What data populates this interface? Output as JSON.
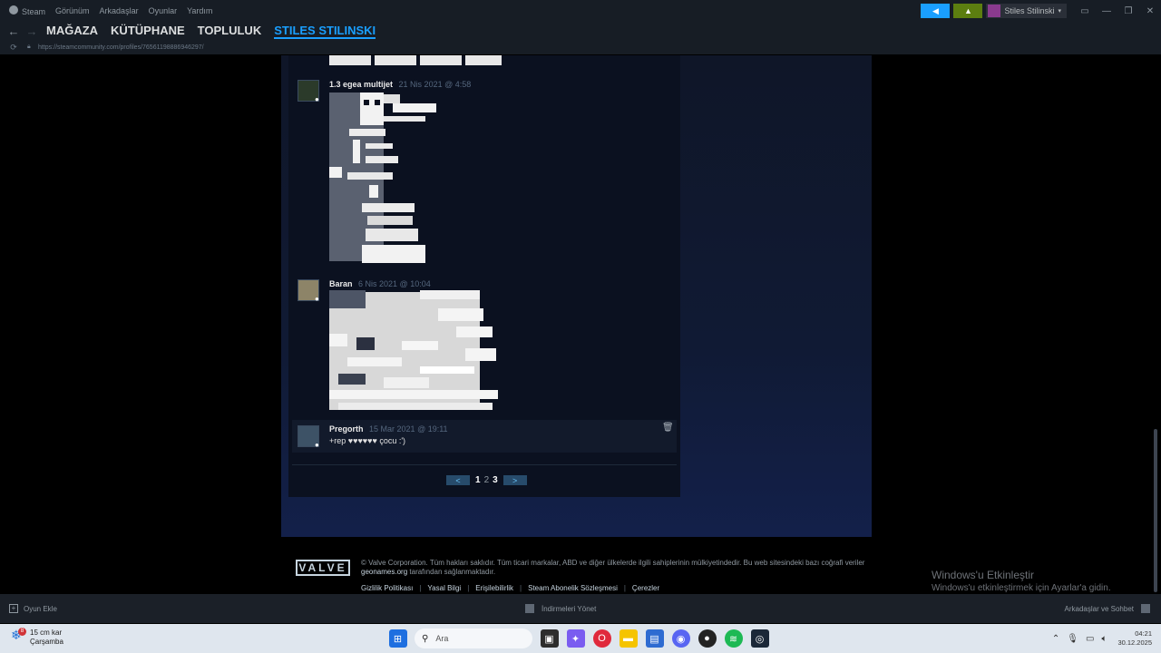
{
  "titlebar": {
    "menu": [
      "Steam",
      "Görünüm",
      "Arkadaşlar",
      "Oyunlar",
      "Yardım"
    ],
    "user_name": "Stiles Stilinski"
  },
  "nav": {
    "links": [
      "MAĞAZA",
      "KÜTÜPHANE",
      "TOPLULUK",
      "STILES STILINSKI"
    ],
    "active_index": 3,
    "url": "https://steamcommunity.com/profiles/76561198886946297/"
  },
  "comments": [
    {
      "author": "1.3 egea multijet",
      "time": "21 Nis 2021 @ 4:58",
      "text": ""
    },
    {
      "author": "Baran",
      "time": "6 Nis 2021 @ 10:04",
      "text": ""
    },
    {
      "author": "Pregorth",
      "time": "15 Mar 2021 @ 19:11",
      "text": "+rep ♥♥♥♥♥♥ çocu :')"
    }
  ],
  "pagination": {
    "prev": "<",
    "pages": [
      "1",
      "2",
      "3"
    ],
    "current": "2",
    "next": ">"
  },
  "footer": {
    "logo": "VALVE",
    "copyright": "© Valve Corporation. Tüm hakları saklıdır. Tüm ticari markalar, ABD ve diğer ülkelerde ilgili sahiplerinin mülkiyetindedir. Bu web sitesindeki bazı coğrafi veriler",
    "geonames": "geonames.org",
    "copyright_tail": "tarafından sağlanmaktadır.",
    "links": [
      "Gizlilik Politikası",
      "Yasal Bilgi",
      "Erişilebilirlik",
      "Steam Abonelik Sözleşmesi",
      "Çerezler"
    ]
  },
  "watermark": {
    "line1": "Windows'u Etkinleştir",
    "line2": "Windows'u etkinleştirmek için Ayarlar'a gidin."
  },
  "steambar": {
    "add_game": "Oyun Ekle",
    "downloads": "İndirmeleri Yönet",
    "friends": "Arkadaşlar ve Sohbet"
  },
  "taskbar": {
    "weather_temp": "15 cm kar",
    "weather_day": "Çarşamba",
    "weather_badge": "8",
    "search_placeholder": "Ara",
    "time": "04:21",
    "date": "30.12.2025"
  },
  "colors": {
    "accent": "#1a9fff",
    "bell": "#5c7e10",
    "titlebar": "#171d25"
  }
}
